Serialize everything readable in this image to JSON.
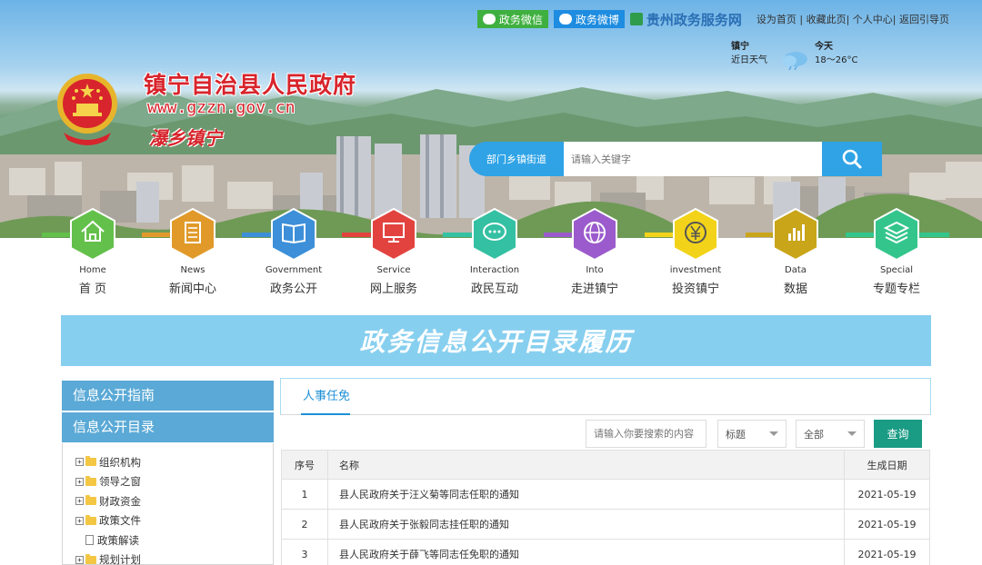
{
  "social": {
    "weixin": "政务微信",
    "weibo": "政务微博",
    "portal": "贵州政务服务网"
  },
  "toplinks": [
    "设为首页",
    "收藏此页",
    "个人中心",
    "返回引导页"
  ],
  "weather": {
    "city": "镇宁",
    "label": "近日天气",
    "day": "今天",
    "temp": "18～26°C"
  },
  "site": {
    "name": "镇宁自治县人民政府",
    "url": "www.gzzn.gov.cn",
    "slogan": "瀑乡镇宁"
  },
  "search": {
    "dept": "部门乡镇街道",
    "placeholder": "请输入关键字"
  },
  "nav": [
    {
      "en": "Home",
      "cn": "首 页",
      "color": "#63c04b",
      "icon": "home-icon"
    },
    {
      "en": "News",
      "cn": "新闻中心",
      "color": "#e19a2a",
      "icon": "newspaper-icon"
    },
    {
      "en": "Government",
      "cn": "政务公开",
      "color": "#3c8fd8",
      "icon": "book-icon"
    },
    {
      "en": "Service",
      "cn": "网上服务",
      "color": "#e2433f",
      "icon": "monitor-icon"
    },
    {
      "en": "Interaction",
      "cn": "政民互动",
      "color": "#34c0a2",
      "icon": "chat-bubble-icon"
    },
    {
      "en": "Into",
      "cn": "走进镇宁",
      "color": "#9b5bcc",
      "icon": "globe-icon"
    },
    {
      "en": "investment",
      "cn": "投资镇宁",
      "color": "#f2d31a",
      "icon": "yen-coin-icon"
    },
    {
      "en": "Data",
      "cn": "数据",
      "color": "#c9a51a",
      "icon": "bar-chart-icon"
    },
    {
      "en": "Special",
      "cn": "专题专栏",
      "color": "#33c58c",
      "icon": "layers-icon"
    }
  ],
  "page_title": "政务信息公开目录履历",
  "sidebar": {
    "guide": "信息公开指南",
    "catalog": "信息公开目录",
    "tree": [
      {
        "label": "组织机构",
        "type": "folder"
      },
      {
        "label": "领导之窗",
        "type": "folder"
      },
      {
        "label": "财政资金",
        "type": "folder"
      },
      {
        "label": "政策文件",
        "type": "folder"
      },
      {
        "label": "政策解读",
        "type": "doc"
      },
      {
        "label": "规划计划",
        "type": "folder"
      }
    ]
  },
  "content": {
    "tab": "人事任免",
    "filter": {
      "placeholder": "请输入你要搜索的内容",
      "field": "标题",
      "scope": "全部",
      "button": "查询"
    },
    "table": {
      "headers": [
        "序号",
        "名称",
        "生成日期"
      ],
      "rows": [
        {
          "no": "1",
          "title": "县人民政府关于汪义菊等同志任职的通知",
          "date": "2021-05-19"
        },
        {
          "no": "2",
          "title": "县人民政府关于张毅同志挂任职的通知",
          "date": "2021-05-19"
        },
        {
          "no": "3",
          "title": "县人民政府关于薛飞等同志任免职的通知",
          "date": "2021-05-19"
        }
      ]
    }
  }
}
